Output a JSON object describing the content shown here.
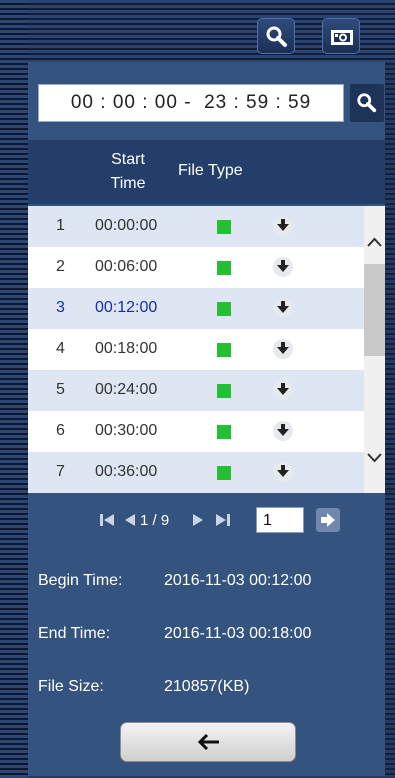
{
  "toolbar": {
    "buttons": [
      {
        "icon": "search-icon"
      },
      {
        "icon": "camera-icon"
      }
    ]
  },
  "search": {
    "time_range": "00 : 00 : 00 -  23 : 59 : 59",
    "search_icon": "search-icon"
  },
  "table": {
    "headers": {
      "start_time_line1": "Start",
      "start_time_line2": "Time",
      "file_type": "File Type"
    },
    "rows": [
      {
        "num": "1",
        "time": "00:00:00"
      },
      {
        "num": "2",
        "time": "00:06:00"
      },
      {
        "num": "3",
        "time": "00:12:00",
        "selected": true
      },
      {
        "num": "4",
        "time": "00:18:00"
      },
      {
        "num": "5",
        "time": "00:24:00"
      },
      {
        "num": "6",
        "time": "00:30:00"
      },
      {
        "num": "7",
        "time": "00:36:00"
      }
    ],
    "file_type_color": "#24c033",
    "selected_color": "#1a2ca8"
  },
  "pager": {
    "label": "1 / 9",
    "page_input": "1"
  },
  "info": {
    "begin_label": "Begin Time:",
    "begin_value": "2016-11-03 00:12:00",
    "end_label": "End Time:",
    "end_value": "2016-11-03 00:18:00",
    "size_label": "File Size:",
    "size_value": "210857(KB)"
  },
  "back_button": {
    "icon": "arrow-left-icon"
  },
  "colors": {
    "panel": "#34537f",
    "header": "#233e69",
    "row_alt": "#dde6f2"
  }
}
